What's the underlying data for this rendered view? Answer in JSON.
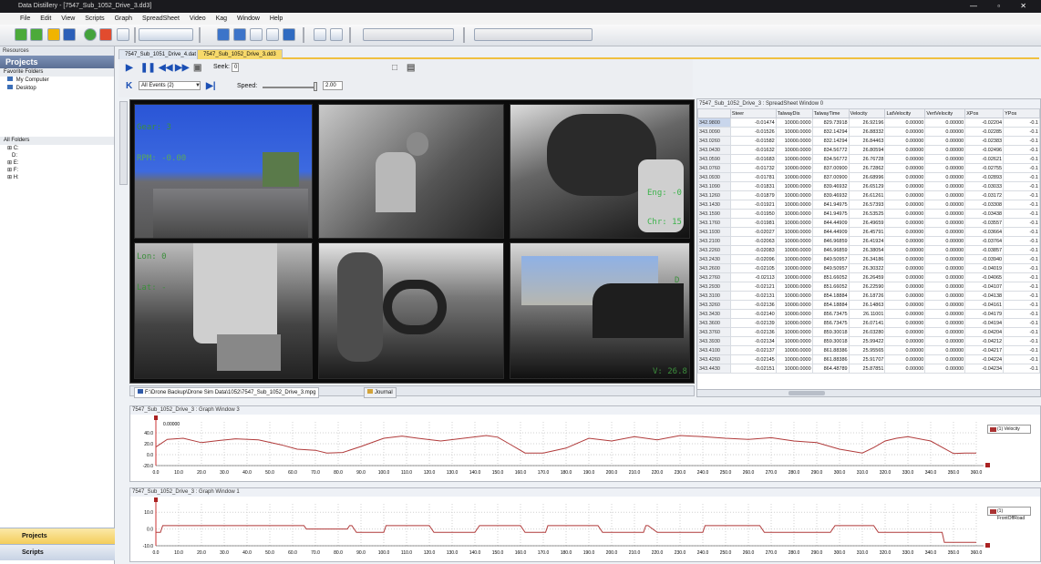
{
  "window": {
    "title": "Data Distillery - [7547_Sub_1052_Drive_3.dd3]",
    "controls": [
      "—",
      "▫",
      "✕"
    ]
  },
  "menu": [
    "File",
    "Edit",
    "View",
    "Scripts",
    "Graph",
    "SpreadSheet",
    "Video",
    "Kag",
    "Window",
    "Help"
  ],
  "left_panel": {
    "resources_label": "Resources",
    "projects_header": "Projects",
    "favorite_folders": "Favorite Folders",
    "favorites": [
      "My Computer",
      "Desktop"
    ],
    "all_folders": "All Folders",
    "drives": [
      "C:",
      "D:",
      "E:",
      "F:",
      "H:"
    ],
    "tabs": [
      "Projects",
      "Scripts"
    ]
  },
  "file_tabs": [
    "7547_Sub_1051_Drive_4.dat",
    "7547_Sub_1052_Drive_3.dd3"
  ],
  "player": {
    "seek_label": "Seek:",
    "seek_value": "0",
    "events_value": "All Events (2)",
    "speed_label": "Speed:",
    "speed_value": "2.00"
  },
  "video": {
    "overlays": {
      "gear": "Gear: 3",
      "rpm": "RPM: -0.00",
      "eng": "Eng: -0",
      "chr": "Chr: 15",
      "lon": "Lon: 0",
      "lat": "Lat: -",
      "v": "V: 26.8",
      "d": "D"
    },
    "tabs": [
      "F:\\Drone Backup\\Drone Sim Data\\1052\\7547_Sub_1052_Drive_3.mpg",
      "Journal"
    ]
  },
  "spreadsheet": {
    "title": "7547_Sub_1052_Drive_3 : SpreadSheet Window 0",
    "columns": [
      "",
      "Steer",
      "TalwayDis",
      "TalwayTime",
      "Velocity",
      "LatVelocity",
      "VertVelocity",
      "XPos",
      "YPos"
    ],
    "rows": [
      [
        "342.9800",
        "-0.01474",
        "10000.0000",
        "829.73918",
        "26.92196",
        "0.00000",
        "0.00000",
        "-0.02204",
        "-0.1"
      ],
      [
        "343.0090",
        "-0.01526",
        "10000.0000",
        "832.14294",
        "26.88332",
        "0.00000",
        "0.00000",
        "-0.02285",
        "-0.1"
      ],
      [
        "343.0260",
        "-0.01582",
        "10000.0000",
        "832.14294",
        "26.84463",
        "0.00000",
        "0.00000",
        "-0.02383",
        "-0.1"
      ],
      [
        "343.0430",
        "-0.01632",
        "10000.0000",
        "834.56772",
        "26.80594",
        "0.00000",
        "0.00000",
        "-0.02496",
        "-0.1"
      ],
      [
        "343.0590",
        "-0.01683",
        "10000.0000",
        "834.56772",
        "26.76728",
        "0.00000",
        "0.00000",
        "-0.02621",
        "-0.1"
      ],
      [
        "343.0760",
        "-0.01732",
        "10000.0000",
        "837.00900",
        "26.72862",
        "0.00000",
        "0.00000",
        "-0.02755",
        "-0.1"
      ],
      [
        "343.0930",
        "-0.01781",
        "10000.0000",
        "837.00900",
        "26.68996",
        "0.00000",
        "0.00000",
        "-0.02893",
        "-0.1"
      ],
      [
        "343.1090",
        "-0.01831",
        "10000.0000",
        "839.46932",
        "26.65129",
        "0.00000",
        "0.00000",
        "-0.03033",
        "-0.1"
      ],
      [
        "343.1260",
        "-0.01879",
        "10000.0000",
        "839.46932",
        "26.61261",
        "0.00000",
        "0.00000",
        "-0.03172",
        "-0.1"
      ],
      [
        "343.1430",
        "-0.01921",
        "10000.0000",
        "841.94975",
        "26.57393",
        "0.00000",
        "0.00000",
        "-0.03308",
        "-0.1"
      ],
      [
        "343.1590",
        "-0.01950",
        "10000.0000",
        "841.94975",
        "26.53525",
        "0.00000",
        "0.00000",
        "-0.03438",
        "-0.1"
      ],
      [
        "343.1760",
        "-0.01981",
        "10000.0000",
        "844.44909",
        "26.49659",
        "0.00000",
        "0.00000",
        "-0.03557",
        "-0.1"
      ],
      [
        "343.1930",
        "-0.02027",
        "10000.0000",
        "844.44909",
        "26.45791",
        "0.00000",
        "0.00000",
        "-0.03664",
        "-0.1"
      ],
      [
        "343.2100",
        "-0.02063",
        "10000.0000",
        "846.96859",
        "26.41924",
        "0.00000",
        "0.00000",
        "-0.03764",
        "-0.1"
      ],
      [
        "343.2260",
        "-0.02083",
        "10000.0000",
        "846.96859",
        "26.38054",
        "0.00000",
        "0.00000",
        "-0.03857",
        "-0.1"
      ],
      [
        "343.2430",
        "-0.02096",
        "10000.0000",
        "849.50957",
        "26.34186",
        "0.00000",
        "0.00000",
        "-0.03940",
        "-0.1"
      ],
      [
        "343.2600",
        "-0.02105",
        "10000.0000",
        "849.50957",
        "26.30322",
        "0.00000",
        "0.00000",
        "-0.04019",
        "-0.1"
      ],
      [
        "343.2760",
        "-0.02113",
        "10000.0000",
        "851.66052",
        "26.26459",
        "0.00000",
        "0.00000",
        "-0.04065",
        "-0.1"
      ],
      [
        "343.2930",
        "-0.02121",
        "10000.0000",
        "851.66052",
        "26.22590",
        "0.00000",
        "0.00000",
        "-0.04107",
        "-0.1"
      ],
      [
        "343.3100",
        "-0.02131",
        "10000.0000",
        "854.18884",
        "26.18726",
        "0.00000",
        "0.00000",
        "-0.04138",
        "-0.1"
      ],
      [
        "343.3260",
        "-0.02136",
        "10000.0000",
        "854.18884",
        "26.14863",
        "0.00000",
        "0.00000",
        "-0.04161",
        "-0.1"
      ],
      [
        "343.3430",
        "-0.02140",
        "10000.0000",
        "856.73475",
        "26.11001",
        "0.00000",
        "0.00000",
        "-0.04179",
        "-0.1"
      ],
      [
        "343.3600",
        "-0.02139",
        "10000.0000",
        "856.73475",
        "26.07141",
        "0.00000",
        "0.00000",
        "-0.04194",
        "-0.1"
      ],
      [
        "343.3760",
        "-0.02136",
        "10000.0000",
        "859.30018",
        "26.03280",
        "0.00000",
        "0.00000",
        "-0.04204",
        "-0.1"
      ],
      [
        "343.3930",
        "-0.02134",
        "10000.0000",
        "859.30018",
        "25.99422",
        "0.00000",
        "0.00000",
        "-0.04212",
        "-0.1"
      ],
      [
        "343.4100",
        "-0.02137",
        "10000.0000",
        "861.88386",
        "25.95565",
        "0.00000",
        "0.00000",
        "-0.04217",
        "-0.1"
      ],
      [
        "343.4260",
        "-0.02145",
        "10000.0000",
        "861.88386",
        "25.91707",
        "0.00000",
        "0.00000",
        "-0.04224",
        "-0.1"
      ],
      [
        "343.4430",
        "-0.02151",
        "10000.0000",
        "864.48789",
        "25.87851",
        "0.00000",
        "0.00000",
        "-0.04234",
        "-0.1"
      ]
    ]
  },
  "graphs": [
    {
      "title": "7547_Sub_1052_Drive_3 : Graph Window 3",
      "marker_value": "0.00000",
      "legend": "(1) Velocity",
      "ylim": [
        -20,
        60
      ],
      "yticks": [
        "40.0",
        "20.0",
        "0.0",
        "-20.0"
      ],
      "xticks": [
        "0.0",
        "10.0",
        "20.0",
        "30.0",
        "40.0",
        "50.0",
        "60.0",
        "70.0",
        "80.0",
        "90.0",
        "100.0",
        "110.0",
        "120.0",
        "130.0",
        "140.0",
        "150.0",
        "160.0",
        "170.0",
        "180.0",
        "190.0",
        "200.0",
        "210.0",
        "220.0",
        "230.0",
        "240.0",
        "250.0",
        "260.0",
        "270.0",
        "280.0",
        "290.0",
        "300.0",
        "310.0",
        "320.0",
        "330.0",
        "340.0",
        "350.0",
        "360.0"
      ],
      "x": [
        0,
        5,
        12,
        20,
        28,
        35,
        45,
        55,
        62,
        70,
        75,
        82,
        90,
        100,
        108,
        115,
        125,
        135,
        145,
        150,
        155,
        162,
        170,
        180,
        190,
        200,
        210,
        220,
        230,
        240,
        250,
        260,
        270,
        280,
        290,
        300,
        310,
        315,
        320,
        325,
        330,
        340,
        350,
        355,
        360
      ],
      "y": [
        14,
        28,
        30,
        22,
        26,
        29,
        27,
        18,
        10,
        8,
        3,
        4,
        15,
        30,
        34,
        30,
        25,
        30,
        35,
        32,
        20,
        3,
        3,
        12,
        30,
        25,
        33,
        27,
        35,
        33,
        30,
        28,
        31,
        25,
        22,
        10,
        3,
        13,
        25,
        30,
        33,
        25,
        2,
        3,
        3
      ],
      "color": "#b03a3a"
    },
    {
      "title": "7547_Sub_1052_Drive_3 : Graph Window 1",
      "legend": "(1) FrontOffRoad",
      "ylim": [
        -10,
        15
      ],
      "yticks": [
        "10.0",
        "0.0",
        "-10.0"
      ],
      "xticks": [
        "0.0",
        "10.0",
        "20.0",
        "30.0",
        "40.0",
        "50.0",
        "60.0",
        "70.0",
        "80.0",
        "90.0",
        "100.0",
        "110.0",
        "120.0",
        "130.0",
        "140.0",
        "150.0",
        "160.0",
        "170.0",
        "180.0",
        "190.0",
        "200.0",
        "210.0",
        "220.0",
        "230.0",
        "240.0",
        "250.0",
        "260.0",
        "270.0",
        "280.0",
        "290.0",
        "300.0",
        "310.0",
        "320.0",
        "330.0",
        "340.0",
        "350.0",
        "360.0"
      ],
      "x": [
        0,
        2,
        3,
        65,
        66,
        84,
        85,
        86,
        88,
        100,
        101,
        120,
        122,
        140,
        142,
        160,
        162,
        171,
        172,
        194,
        196,
        214,
        215,
        216,
        220,
        240,
        241,
        265,
        267,
        296,
        298,
        315,
        317,
        345,
        346,
        360
      ],
      "y": [
        -2,
        -2,
        2,
        2,
        0,
        0,
        2,
        2,
        -2,
        -2,
        2,
        2,
        -2,
        -2,
        2,
        2,
        -2,
        -2,
        2,
        2,
        -2,
        -2,
        2,
        2,
        -2,
        -2,
        2,
        2,
        -2,
        -2,
        2,
        2,
        -2,
        -2,
        -8,
        -8
      ],
      "color": "#b03a3a"
    }
  ]
}
